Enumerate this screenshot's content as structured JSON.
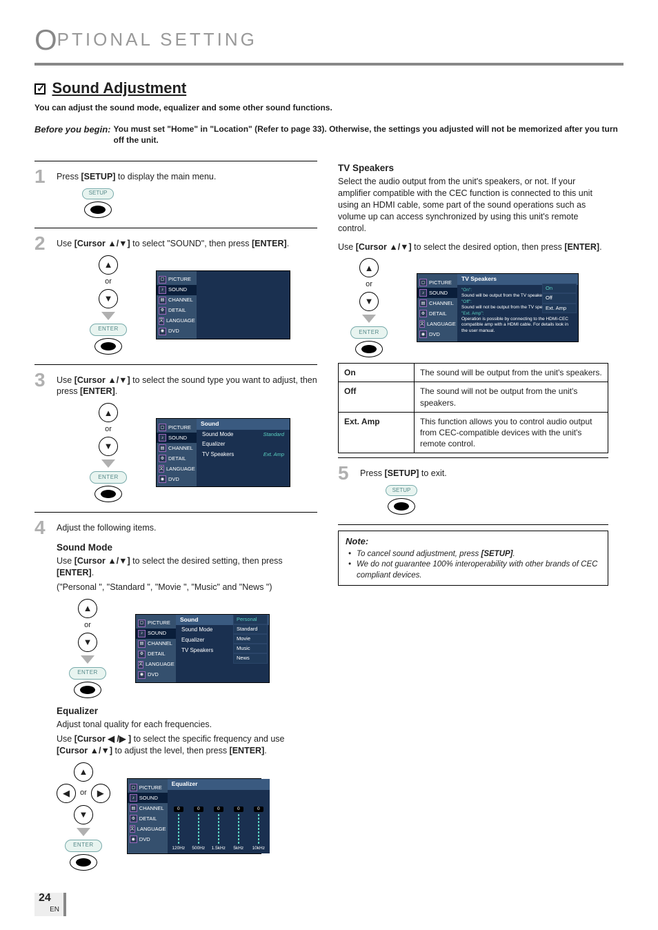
{
  "chapter": {
    "title_rest": "PTIONAL  SETTING"
  },
  "section": {
    "title": "Sound Adjustment",
    "intro": "You can adjust the sound mode, equalizer and some other sound functions.",
    "before_label": "Before you begin:",
    "before_body": "You must set \"Home\" in \"Location\" (Refer to page 33). Otherwise, the settings you adjusted will not be memorized after you turn off the unit."
  },
  "steps": {
    "s1": {
      "num": "1",
      "pre": "Press ",
      "key": "[SETUP]",
      "post": " to display the main menu."
    },
    "s2": {
      "num": "2",
      "pre": "Use ",
      "key": "[Cursor ▲/▼]",
      "mid": " to select \"SOUND\", then press ",
      "key2": "[ENTER]",
      "post": "."
    },
    "s3": {
      "num": "3",
      "pre": "Use ",
      "key": "[Cursor ▲/▼]",
      "mid": " to select the sound type you want to adjust, then press ",
      "key2": "[ENTER]",
      "post": "."
    },
    "s4": {
      "num": "4",
      "text": "Adjust the following items."
    },
    "s5": {
      "num": "5",
      "pre": "Press ",
      "key": "[SETUP]",
      "post": " to exit."
    }
  },
  "sound_mode": {
    "head": "Sound Mode",
    "l1a": "Use ",
    "l1b": "[Cursor ▲/▼]",
    "l1c": " to select the desired setting, then press ",
    "l1d": "[ENTER]",
    "l1e": ".",
    "l2": "(\"Personal \", \"Standard \", \"Movie \", \"Music\" and \"News \")"
  },
  "equalizer": {
    "head": "Equalizer",
    "l1": "Adjust tonal quality for each frequencies.",
    "l2a": "Use ",
    "l2b": "[Cursor ◀ /▶ ]",
    "l2c": " to select the specific frequency and use ",
    "l2d": "[Cursor ▲/▼]",
    "l2e": " to adjust the level, then press ",
    "l2f": "[ENTER]",
    "l2g": "."
  },
  "tvspeakers": {
    "head": "TV Speakers",
    "para": "Select the audio output from the unit's speakers, or not. If your amplifier compatible with the CEC function is connected to this unit using an HDMI cable, some part of the sound operations such as volume up can access synchronized by using this unit's remote control.",
    "l1a": "Use ",
    "l1b": "[Cursor ▲/▼]",
    "l1c": " to select the desired option, then press ",
    "l1d": "[ENTER]",
    "l1e": ".",
    "table": {
      "r1k": "On",
      "r1v": "The sound will be output from the unit's speakers.",
      "r2k": "Off",
      "r2v": "The sound will not be output from the unit's speakers.",
      "r3k": "Ext. Amp",
      "r3v": "This function allows you to control audio output from CEC-compatible devices with the unit's remote control."
    }
  },
  "note": {
    "title": "Note:",
    "n1a": "To cancel sound adjustment, press ",
    "n1b": "[SETUP]",
    "n1c": ".",
    "n2": "We do not guarantee 100% interoperability with other brands of CEC compliant devices."
  },
  "osd": {
    "menu": {
      "picture": "PICTURE",
      "sound": "SOUND",
      "channel": "CHANNEL",
      "detail": "DETAIL",
      "language": "LANGUAGE",
      "dvd": "DVD"
    },
    "sound_title": "Sound",
    "rows": {
      "mode": "Sound Mode",
      "eq": "Equalizer",
      "tv": "TV Speakers"
    },
    "vals": {
      "standard": "Standard",
      "extamp": "Ext. Amp"
    },
    "mode_opts": [
      "Personal",
      "Standard",
      "Movie",
      "Music",
      "News"
    ],
    "eq_title": "Equalizer",
    "eq_vals": [
      "0",
      "0",
      "0",
      "0",
      "0"
    ],
    "eq_labs": [
      "120Hz",
      "500Hz",
      "1.5kHz",
      "5kHz",
      "10kHz"
    ],
    "tv_title": "TV Speakers",
    "tv_opts": [
      "On",
      "Off",
      "Ext. Amp"
    ],
    "tv_desc_on_h": "\"On\":",
    "tv_desc_on": "Sound will be output from the TV speakers.",
    "tv_desc_off_h": "\"Off\":",
    "tv_desc_off": "Sound will not be output from the TV speakers.",
    "tv_desc_ext_h": "\"Ext. Amp\":",
    "tv_desc_ext": "Operation is possible by connecting to the HDMI-CEC compatible amp with a HDMI cable. For details look in the user manual."
  },
  "remote": {
    "or": "or",
    "enter": "ENTER",
    "setup": "SETUP"
  },
  "page": {
    "num": "24",
    "lang": "EN"
  }
}
